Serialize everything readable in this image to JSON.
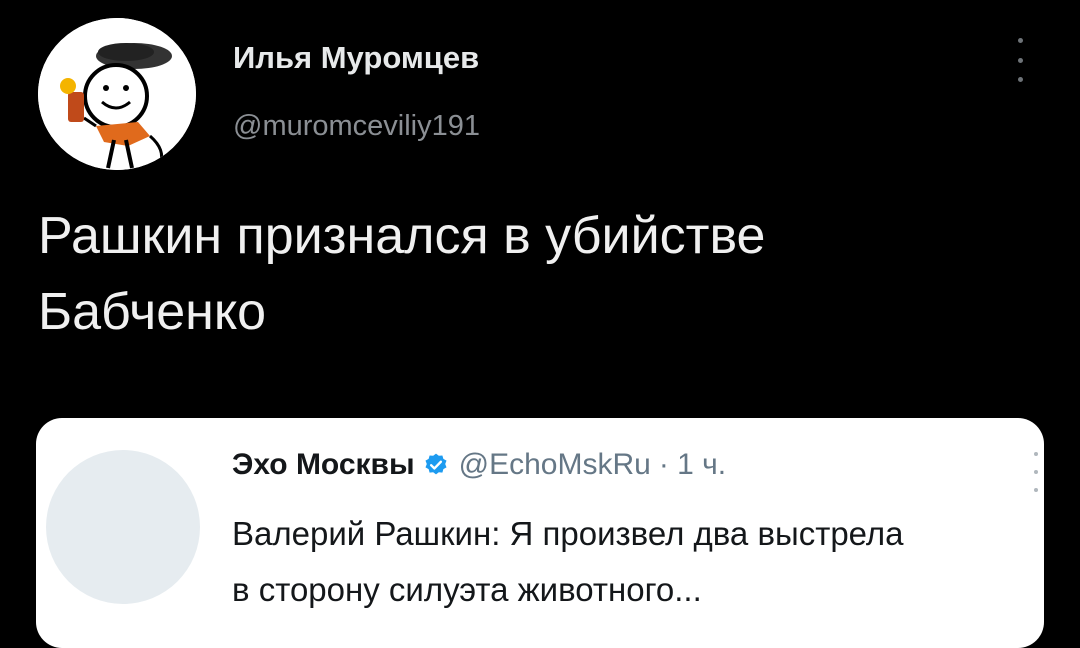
{
  "author": {
    "name": "Илья Муромцев",
    "handle": "@muromceviliy191"
  },
  "tweet": {
    "lines": [
      "Рашкин признался в убийстве",
      "Бабченко"
    ]
  },
  "quoted": {
    "name": "Эхо Москвы",
    "handle": "@EchoMskRu",
    "time": "· 1 ч.",
    "lines": [
      "Валерий Рашкин: Я произвел два выстрела",
      "в сторону силуэта животного..."
    ]
  },
  "icons": {
    "more": "more-vertical-icon",
    "verified": "verified-badge-icon"
  },
  "colors": {
    "background": "#000000",
    "primary_text": "#e7e9ea",
    "secondary_text": "#8b8f94",
    "verified": "#1d9bf0"
  }
}
